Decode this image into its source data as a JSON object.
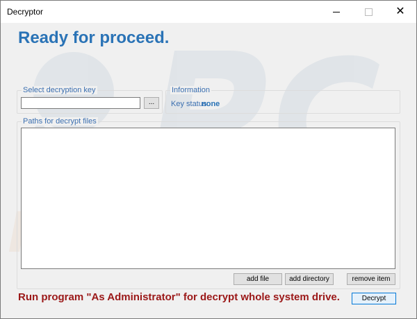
{
  "window": {
    "title": "Decryptor",
    "close_glyph": "✕"
  },
  "main": {
    "headline": "Ready for proceed."
  },
  "key_group": {
    "legend": "Select decryption key",
    "key_value": "",
    "browse_label": "..."
  },
  "info_group": {
    "legend": "Information",
    "key_status_label": "Key status:",
    "key_status_value": "none"
  },
  "paths_group": {
    "legend": "Paths for decrypt files",
    "paths": [],
    "add_file_label": "add file",
    "add_directory_label": "add directory",
    "remove_item_label": "remove item"
  },
  "footer": {
    "warning": "Run program \"As Administrator\" for decrypt whole system drive.",
    "decrypt_label": "Decrypt"
  },
  "colors": {
    "headline": "#2a73b6",
    "warning": "#9b1818",
    "legend": "#3b6fb0"
  },
  "watermark": {
    "logo_text": "risk.com"
  }
}
